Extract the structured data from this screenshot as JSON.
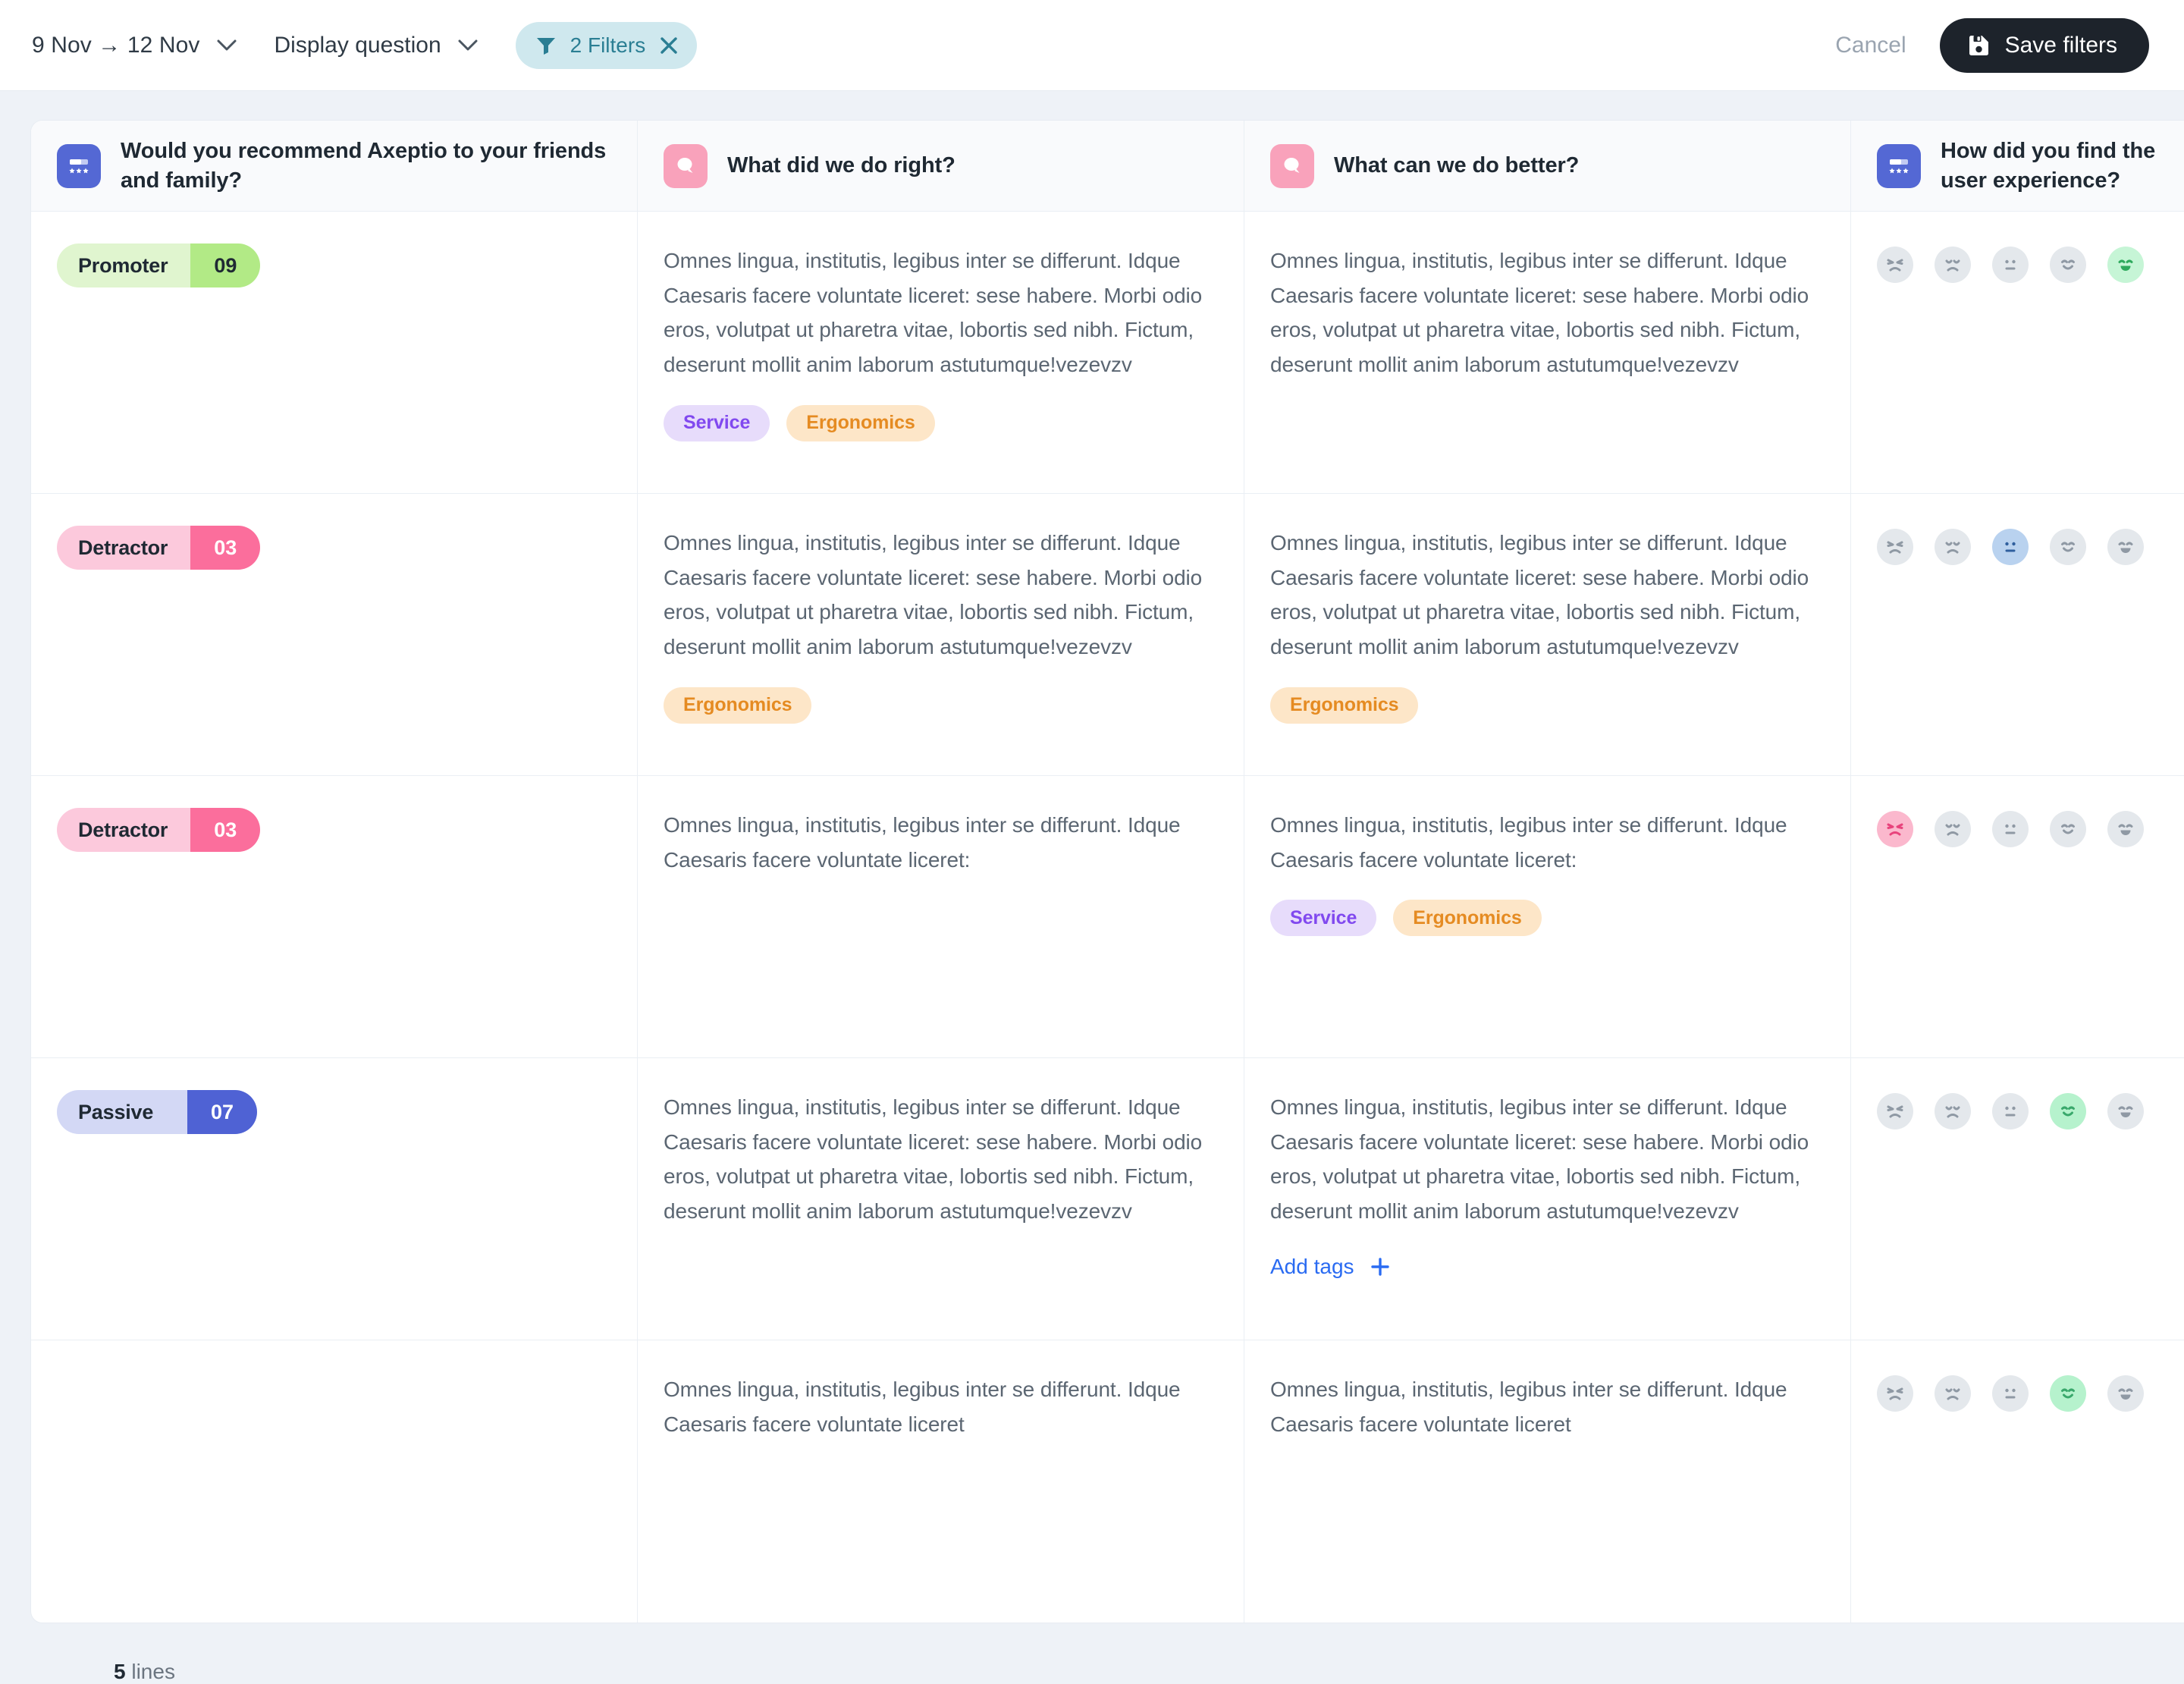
{
  "toolbar": {
    "date_range": "9 Nov → 12 Nov",
    "display_question": "Display question",
    "filters_label": "2 Filters",
    "cancel_label": "Cancel",
    "save_label": "Save filters"
  },
  "columns": [
    {
      "title": "Would you recommend Axeptio to your friends and family?",
      "icon": "rating-icon",
      "icon_color": "#5468d4"
    },
    {
      "title": "What did we do right?",
      "icon": "chat-bubble-icon",
      "icon_color": "#f9a2bb"
    },
    {
      "title": "What can we do better?",
      "icon": "chat-bubble-icon",
      "icon_color": "#f9a2bb"
    },
    {
      "title": "How did you find the user experience?",
      "icon": "rating-icon",
      "icon_color": "#5468d4"
    }
  ],
  "long_text": "Omnes lingua, institutis, legibus inter se differunt. Idque Caesaris facere voluntate liceret: sese habere. Morbi odio eros, volutpat ut pharetra vitae, lobortis sed nibh. Fictum, deserunt mollit anim laborum astutumque!vezevzv",
  "short_text": "Omnes lingua, institutis, legibus inter se differunt. Idque Caesaris facere voluntate liceret:",
  "shortest_text": "Omnes lingua, institutis, legibus inter se differunt. Idque Caesaris facere voluntate liceret",
  "add_tags_label": "Add tags",
  "rows": [
    {
      "nps": {
        "label": "Promoter",
        "score": "09",
        "type": "promoter"
      },
      "right": {
        "text_key": "long_text",
        "tags": [
          {
            "label": "Service",
            "type": "service"
          },
          {
            "label": "Ergonomics",
            "type": "ergonomics"
          }
        ]
      },
      "better": {
        "text_key": "long_text",
        "tags": []
      },
      "rating": {
        "selected": 5,
        "selected_color": "#2faa5d"
      }
    },
    {
      "nps": {
        "label": "Detractor",
        "score": "03",
        "type": "detractor"
      },
      "right": {
        "text_key": "long_text",
        "tags": [
          {
            "label": "Ergonomics",
            "type": "ergonomics"
          }
        ]
      },
      "better": {
        "text_key": "long_text",
        "tags": [
          {
            "label": "Ergonomics",
            "type": "ergonomics"
          }
        ]
      },
      "rating": {
        "selected": 3,
        "selected_color": "#2f5f9e"
      }
    },
    {
      "nps": {
        "label": "Detractor",
        "score": "03",
        "type": "detractor"
      },
      "right": {
        "text_key": "short_text",
        "tags": []
      },
      "better": {
        "text_key": "short_text",
        "tags": [
          {
            "label": "Service",
            "type": "service"
          },
          {
            "label": "Ergonomics",
            "type": "ergonomics"
          }
        ]
      },
      "rating": {
        "selected": 1,
        "selected_color": "#e8437c"
      }
    },
    {
      "nps": {
        "label": "Passive",
        "score": "07",
        "type": "passive"
      },
      "right": {
        "text_key": "long_text",
        "tags": []
      },
      "better": {
        "text_key": "long_text",
        "tags": [],
        "add_tags": true
      },
      "rating": {
        "selected": 4,
        "selected_color": "#39a86b"
      }
    },
    {
      "nps": null,
      "right": {
        "text_key": "shortest_text",
        "tags": []
      },
      "better": {
        "text_key": "shortest_text",
        "tags": []
      },
      "rating": {
        "selected": 4,
        "selected_color": "#39a86b"
      }
    }
  ],
  "footer": {
    "count": "5",
    "label": "lines"
  },
  "colors": {
    "accent_filter": "#cfe8ee",
    "filter_text": "#2a7e93",
    "save_bg": "#1d232b",
    "link": "#2a6bf2",
    "promoter": "#b2ea86",
    "detractor": "#fb6e9c",
    "passive": "#4f62d4"
  }
}
